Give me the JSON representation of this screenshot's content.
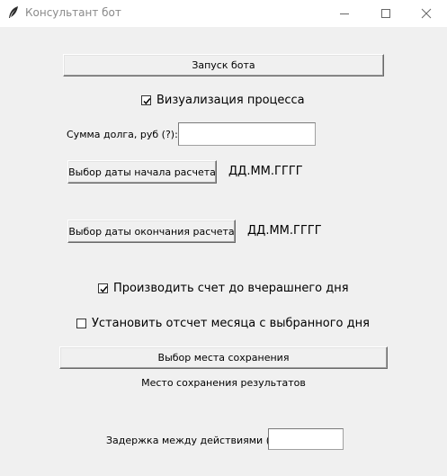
{
  "window": {
    "title": "Консультант бот",
    "icon": "feather-icon",
    "controls": [
      "minimize-icon",
      "maximize-icon",
      "close-icon"
    ]
  },
  "main": {
    "start_button_label": "Запуск бота",
    "visualize_label": "Визуализация процесса",
    "visualize_checked": true,
    "debt_label": "Сумма долга, руб (?):",
    "debt_value": "",
    "start_date_button_label": "Выбор даты начала расчета",
    "start_date_value": "ДД.ММ.ГГГГ",
    "end_date_button_label": "Выбор даты окончания расчета",
    "end_date_value": "ДД.ММ.ГГГГ",
    "until_yesterday_label": "Производить счет до вчерашнего дня",
    "until_yesterday_checked": true,
    "month_from_day_label": "Установить отсчет месяца с выбранного дня",
    "month_from_day_checked": false,
    "save_location_button_label": "Выбор места сохранения",
    "save_location_text": "Место сохранения результатов",
    "delay_label": "Задержка между действиями (?)",
    "delay_value": ""
  }
}
